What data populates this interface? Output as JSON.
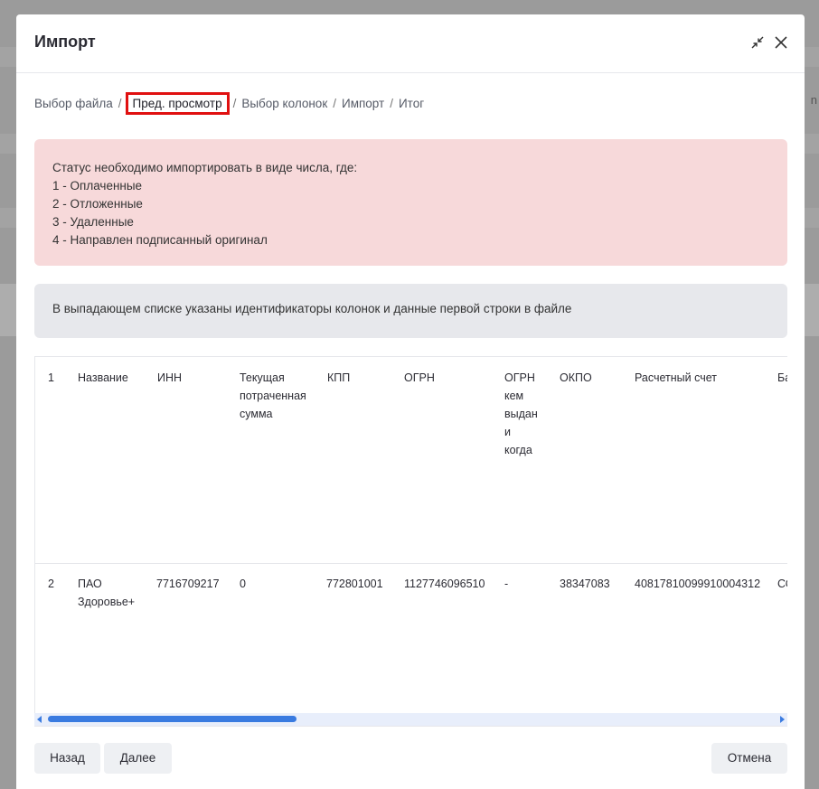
{
  "dialog": {
    "title": "Импорт",
    "breadcrumb": [
      "Выбор файла",
      "Пред. просмотр",
      "Выбор колонок",
      "Импорт",
      "Итог"
    ],
    "breadcrumb_separator": "/",
    "info_status": [
      "Статус необходимо импортировать в виде числа, где:",
      "1 - Оплаченные",
      "2 - Отложенные",
      "3 - Удаленные",
      "4 - Направлен подписанный оригинал"
    ],
    "info_columns": "В выпадающем списке указаны идентификаторы колонок и данные первой строки в файле",
    "table": {
      "rows": [
        [
          "1",
          "Название",
          "ИНН",
          "Текущая потраченная сумма",
          "КПП",
          "ОГРН",
          "ОГРН кем выдан и когда",
          "ОКПО",
          "Расчетный счет",
          "Ба"
        ],
        [
          "2",
          "ПАО Здоровье+",
          "7716709217",
          "0",
          "772801001",
          "1127746096510",
          "-",
          "38347083",
          "40817810099910004312",
          "СО"
        ]
      ]
    },
    "buttons": {
      "back": "Назад",
      "next": "Далее",
      "cancel": "Отмена"
    }
  },
  "background": {
    "right_glyph": "n"
  },
  "colors": {
    "accent": "#3a7be0",
    "alert_red_bg": "#f7d9da",
    "alert_grey_bg": "#e7e8ec",
    "highlight_border": "#e01010"
  }
}
